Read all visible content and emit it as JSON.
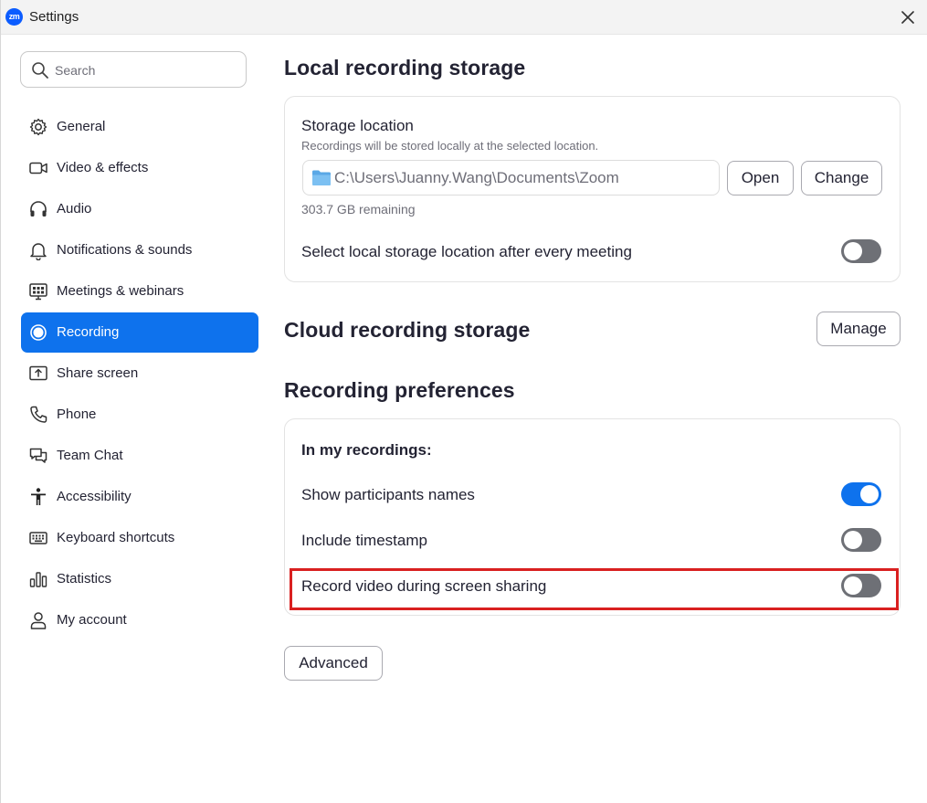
{
  "window": {
    "title": "Settings",
    "app_logo_text": "zm"
  },
  "search": {
    "placeholder": "Search"
  },
  "sidebar": {
    "items": [
      {
        "label": "General",
        "icon": "gear-icon"
      },
      {
        "label": "Video & effects",
        "icon": "video-camera-icon"
      },
      {
        "label": "Audio",
        "icon": "headphones-icon"
      },
      {
        "label": "Notifications & sounds",
        "icon": "bell-icon"
      },
      {
        "label": "Meetings & webinars",
        "icon": "meetings-icon"
      },
      {
        "label": "Recording",
        "icon": "record-icon",
        "active": true
      },
      {
        "label": "Share screen",
        "icon": "share-screen-icon"
      },
      {
        "label": "Phone",
        "icon": "phone-icon"
      },
      {
        "label": "Team Chat",
        "icon": "chat-icon"
      },
      {
        "label": "Accessibility",
        "icon": "accessibility-icon"
      },
      {
        "label": "Keyboard shortcuts",
        "icon": "keyboard-icon"
      },
      {
        "label": "Statistics",
        "icon": "bar-chart-icon"
      },
      {
        "label": "My account",
        "icon": "user-icon"
      }
    ]
  },
  "local_storage": {
    "heading": "Local recording storage",
    "location_label": "Storage location",
    "location_desc": "Recordings will be stored locally at the selected location.",
    "path": "C:\\Users\\Juanny.Wang\\Documents\\Zoom",
    "open_label": "Open",
    "change_label": "Change",
    "remaining": "303.7 GB remaining",
    "select_after_meeting_label": "Select local storage location after every meeting",
    "select_after_meeting_on": false
  },
  "cloud_storage": {
    "heading": "Cloud recording storage",
    "manage_label": "Manage"
  },
  "preferences": {
    "heading": "Recording preferences",
    "subheading": "In my recordings:",
    "options": [
      {
        "label": "Show participants names",
        "on": true
      },
      {
        "label": "Include timestamp",
        "on": false
      },
      {
        "label": "Record video during screen sharing",
        "on": false,
        "highlighted": true
      }
    ],
    "advanced_label": "Advanced"
  },
  "colors": {
    "accent": "#0e72ed",
    "toggle_off": "#6e7076",
    "highlight": "#d92020",
    "folder": "#5aa8e6"
  }
}
